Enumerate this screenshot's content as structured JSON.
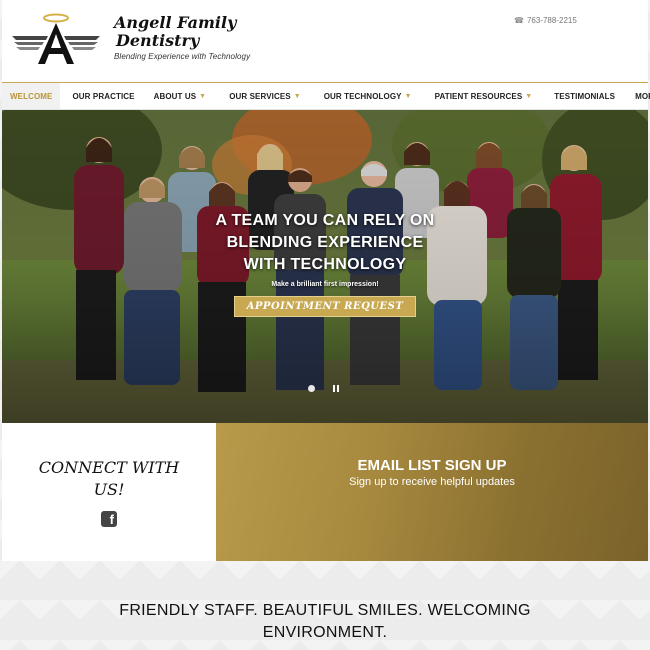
{
  "brand": {
    "name": "Angell Family Dentistry",
    "name_line1": "Angell Family",
    "name_line2": "Dentistry",
    "tagline": "Blending Experience with Technology",
    "logo_icon": "winged-a-halo-logo"
  },
  "header": {
    "phone": "763-788-2215",
    "phone_icon": "phone-icon"
  },
  "nav": {
    "items": [
      {
        "label": "WELCOME",
        "active": true,
        "dropdown": false
      },
      {
        "label": "OUR PRACTICE",
        "active": false,
        "dropdown": false
      },
      {
        "label": "ABOUT US",
        "active": false,
        "dropdown": true
      },
      {
        "label": "OUR SERVICES",
        "active": false,
        "dropdown": true
      },
      {
        "label": "OUR TECHNOLOGY",
        "active": false,
        "dropdown": true
      },
      {
        "label": "PATIENT RESOURCES",
        "active": false,
        "dropdown": true
      },
      {
        "label": "TESTIMONIALS",
        "active": false,
        "dropdown": false
      },
      {
        "label": "MORE",
        "active": false,
        "dropdown": true
      }
    ],
    "caret": "▼"
  },
  "hero": {
    "line1": "A TEAM YOU CAN RELY ON",
    "line2": "BLENDING EXPERIENCE",
    "line3": "WITH TECHNOLOGY",
    "subtext": "Make a brilliant first impression!",
    "button_label": "APPOINTMENT REQUEST"
  },
  "connect": {
    "title_line1": "CONNECT WITH",
    "title_line2": "US!",
    "icon": "facebook-icon"
  },
  "email": {
    "title": "EMAIL LIST SIGN UP",
    "subtitle": "Sign up to receive helpful updates"
  },
  "tagline": {
    "line1": "FRIENDLY STAFF. BEAUTIFUL SMILES. WELCOMING",
    "line2": "ENVIRONMENT."
  },
  "colors": {
    "accent_gold": "#c9a852",
    "email_gradient_end": "#7b622a"
  }
}
